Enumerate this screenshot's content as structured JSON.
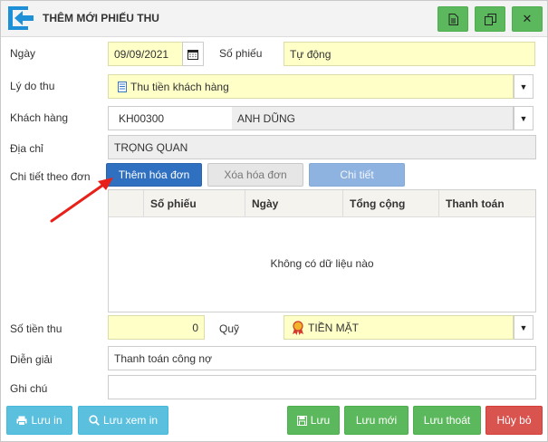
{
  "window": {
    "title": "THÊM MỚI PHIẾU THU"
  },
  "toolbar": {
    "icons": [
      "document-icon",
      "copy-icon",
      "close-icon"
    ],
    "close_glyph": "✕"
  },
  "form": {
    "date": {
      "label": "Ngày",
      "value": "09/09/2021"
    },
    "doc_no": {
      "label": "Số phiếu",
      "value": "Tự động"
    },
    "reason": {
      "label": "Lý do thu",
      "value": "Thu tiền khách hàng"
    },
    "customer": {
      "label": "Khách hàng",
      "code": "KH00300",
      "name": "ANH DŨNG"
    },
    "address": {
      "label": "Địa chỉ",
      "value": "TRỌNG QUAN"
    },
    "detail": {
      "label": "Chi tiết theo đơn",
      "add_label": "Thêm hóa đơn",
      "remove_label": "Xóa hóa đơn",
      "view_label": "Chi tiết"
    },
    "amount": {
      "label": "Số tiền thu",
      "value": "0"
    },
    "fund": {
      "label": "Quỹ",
      "value": "TIỀN MẶT"
    },
    "description": {
      "label": "Diễn giải",
      "value": "Thanh toán công nợ"
    },
    "note": {
      "label": "Ghi chú",
      "value": ""
    }
  },
  "table": {
    "columns": [
      "Số phiếu",
      "Ngày",
      "Tổng cộng",
      "Thanh toán"
    ],
    "empty_text": "Không có dữ liệu nào"
  },
  "footer": {
    "print_label": "Lưu in",
    "print_preview_label": "Lưu xem in",
    "save_label": "Lưu",
    "save_new_label": "Lưu mới",
    "save_exit_label": "Lưu thoát",
    "cancel_label": "Hủy bỏ"
  },
  "colors": {
    "primary": "#2f70c0",
    "success": "#5cb85c",
    "info": "#5bc0de",
    "danger": "#d9534f",
    "annotation_arrow": "#e8201a"
  }
}
